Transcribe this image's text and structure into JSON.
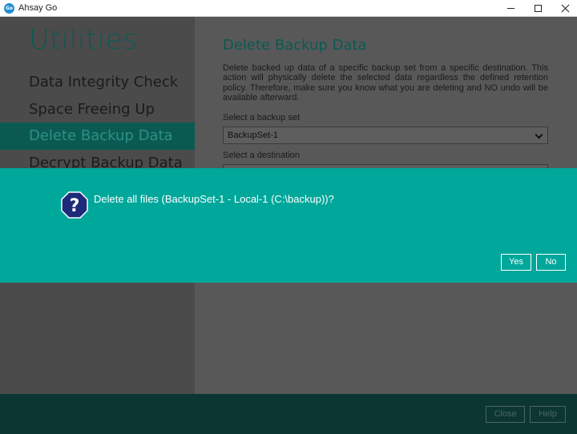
{
  "window": {
    "title": "Ahsay Go",
    "logo_text": "Go",
    "icons": [
      "minimize-icon",
      "maximize-icon",
      "close-icon"
    ]
  },
  "sidebar": {
    "title": "Utilities",
    "items": [
      {
        "label": "Data Integrity Check"
      },
      {
        "label": "Space Freeing Up"
      },
      {
        "label": "Delete Backup Data",
        "active": true
      },
      {
        "label": "Decrypt Backup Data"
      }
    ]
  },
  "main": {
    "title": "Delete Backup Data",
    "description": "Delete backed up data of a specific backup set from a specific destination. This action will physically delete the selected data regardless the defined retention policy. Therefore, make sure you know what you are deleting and NO undo will be available afterward.",
    "backup_set_label": "Select a backup set",
    "backup_set_value": "BackupSet-1",
    "destination_label": "Select a destination"
  },
  "footer": {
    "close_label": "Close",
    "help_label": "Help"
  },
  "dialog": {
    "icon": "question-icon",
    "message": "Delete all files (BackupSet-1 - Local-1 (C:\\backup))?",
    "yes_label": "Yes",
    "no_label": "No",
    "accent_color": "#00a79b"
  }
}
